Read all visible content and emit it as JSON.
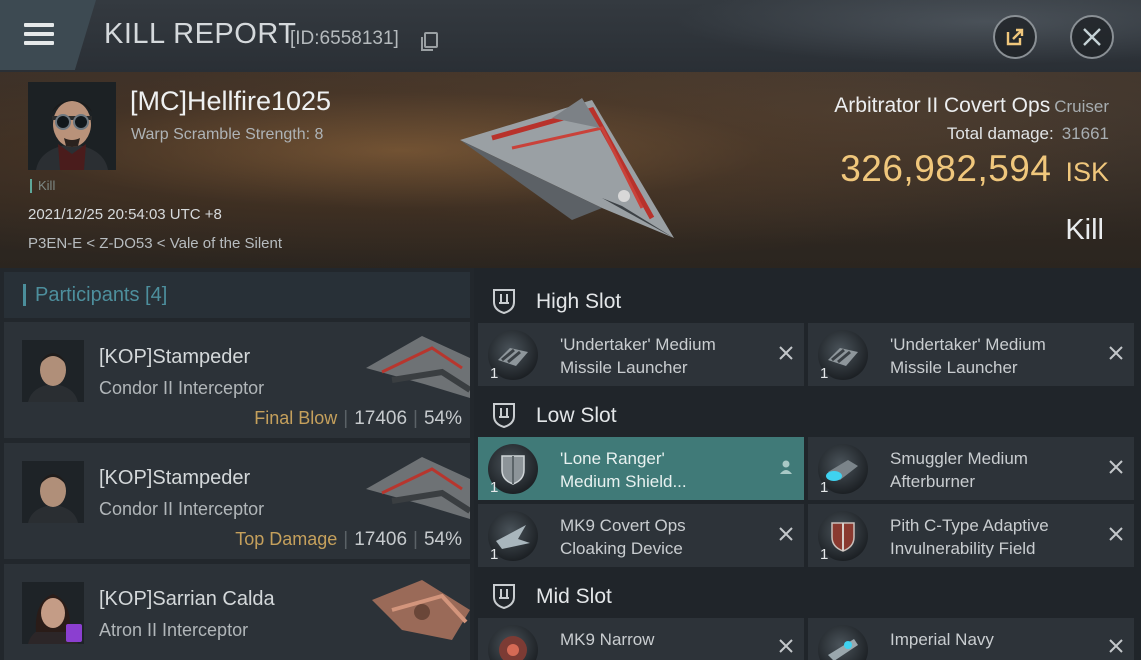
{
  "titlebar": {
    "title": "KILL REPORT",
    "report_id": "[ID:6558131]"
  },
  "victim": {
    "pilot": "[MC]Hellfire1025",
    "scramble": "Warp Scramble Strength: 8",
    "tag": "Kill",
    "timestamp": "2021/12/25 20:54:03 UTC +8",
    "location": "P3EN-E < Z-DO53 < Vale of the Silent",
    "ship": "Arbitrator II Covert Ops",
    "ship_class": "Cruiser",
    "damage_label": "Total damage:",
    "damage_value": "31661",
    "isk_value": "326,982,594",
    "isk_unit": "ISK",
    "result": "Kill"
  },
  "participants": {
    "title": "Participants [4]",
    "rows": [
      {
        "name": "[KOP]Stampeder",
        "ship": "Condor II Interceptor",
        "role": "Final Blow",
        "damage": "17406",
        "percent": "54%"
      },
      {
        "name": "[KOP]Stampeder",
        "ship": "Condor II Interceptor",
        "role": "Top Damage",
        "damage": "17406",
        "percent": "54%"
      },
      {
        "name": "[KOP]Sarrian Calda",
        "ship": "Atron II Interceptor",
        "role": "",
        "damage": "",
        "percent": ""
      }
    ]
  },
  "slots": {
    "high": {
      "title": "High Slot",
      "items": [
        {
          "line1": "'Undertaker' Medium",
          "line2": "Missile Launcher",
          "qty": "1",
          "icon": "missile-launcher-icon"
        },
        {
          "line1": "'Undertaker' Medium",
          "line2": "Missile Launcher",
          "qty": "1",
          "icon": "missile-launcher-icon"
        }
      ]
    },
    "low": {
      "title": "Low Slot",
      "items": [
        {
          "line1": "'Lone Ranger'",
          "line2": "Medium Shield...",
          "qty": "1",
          "icon": "shield-module-icon"
        },
        {
          "line1": "Smuggler Medium",
          "line2": "Afterburner",
          "qty": "1",
          "icon": "afterburner-icon"
        },
        {
          "line1": "MK9 Covert Ops",
          "line2": "Cloaking Device",
          "qty": "1",
          "icon": "cloaking-device-icon"
        },
        {
          "line1": "Pith C-Type Adaptive",
          "line2": "Invulnerability Field",
          "qty": "1",
          "icon": "invulnerability-field-icon"
        }
      ]
    },
    "mid": {
      "title": "Mid Slot",
      "items": [
        {
          "line1": "MK9 Narrow",
          "line2": "",
          "qty": "",
          "icon": "scanner-icon"
        },
        {
          "line1": "Imperial Navy",
          "line2": "",
          "qty": "",
          "icon": "navy-module-icon"
        }
      ]
    }
  },
  "colors": {
    "isk": "#f0c77c",
    "role": "#c5a05c",
    "accent": "#4d8f9d",
    "selected": "#407a78"
  }
}
